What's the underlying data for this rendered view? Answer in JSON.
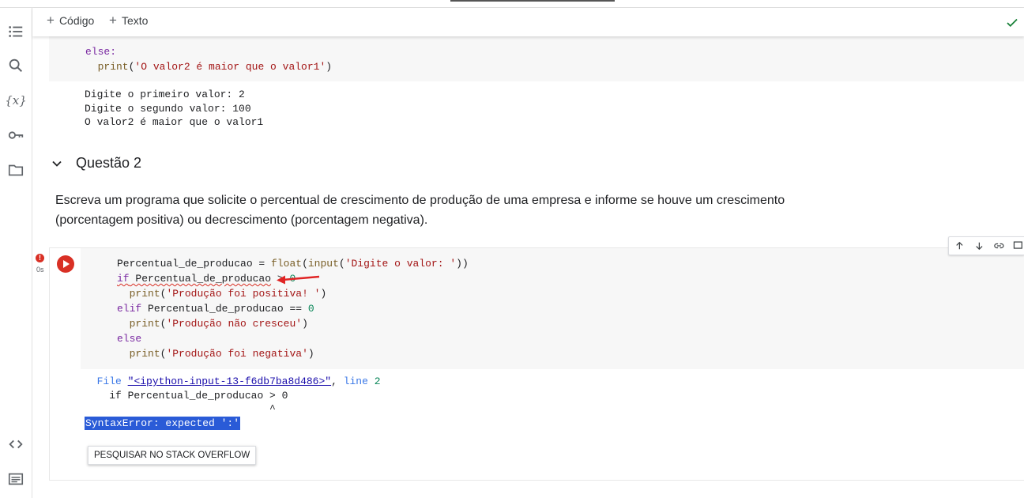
{
  "toolbar": {
    "add_code_label": "Código",
    "add_text_label": "Texto",
    "plus_symbol": "+"
  },
  "sidebar": {
    "icons": [
      "table-of-contents-icon",
      "search-icon",
      "variables-icon",
      "key-icon",
      "folder-icon",
      "code-snippets-icon",
      "terminal-icon"
    ],
    "variables_glyph": "{x}"
  },
  "prev_cell": {
    "code_lines": [
      "else:",
      "  print('O valor2 é maior que o valor1')"
    ],
    "output_lines": [
      "Digite o primeiro valor: 2",
      "Digite o segundo valor: 100",
      "O valor2 é maior que o valor1"
    ]
  },
  "section": {
    "title": "Questão 2",
    "description": "Escreva um programa que solicite o percentual de crescimento de produção de uma empresa e informe se houve um crescimento (porcentagem positiva) ou decrescimento (porcentagem negativa)."
  },
  "cell": {
    "exec_time": "0s",
    "error_badge": "!",
    "code_lines": [
      "Percentual_de_producao = float(input('Digite o valor: '))",
      "if Percentual_de_producao > 0",
      "  print('Produção foi positiva! ')",
      "elif Percentual_de_producao == 0",
      "  print('Produção não cresceu')",
      "else",
      "  print('Produção foi negativa')"
    ],
    "traceback": {
      "file_label": "File",
      "file_link": "\"<ipython-input-13-f6db7ba8d486>\"",
      "line_label": "line",
      "line_num": "2",
      "source_line": "if Percentual_de_producao > 0",
      "caret": "^"
    },
    "error_text": "SyntaxError: expected ':'",
    "stackoverflow_button": "PESQUISAR NO STACK OVERFLOW"
  },
  "colors": {
    "run_button": "#d93025",
    "keyword": "#7928a1",
    "string": "#a31515",
    "number": "#098658",
    "error_highlight": "#2a5bd7",
    "check": "#188038"
  }
}
